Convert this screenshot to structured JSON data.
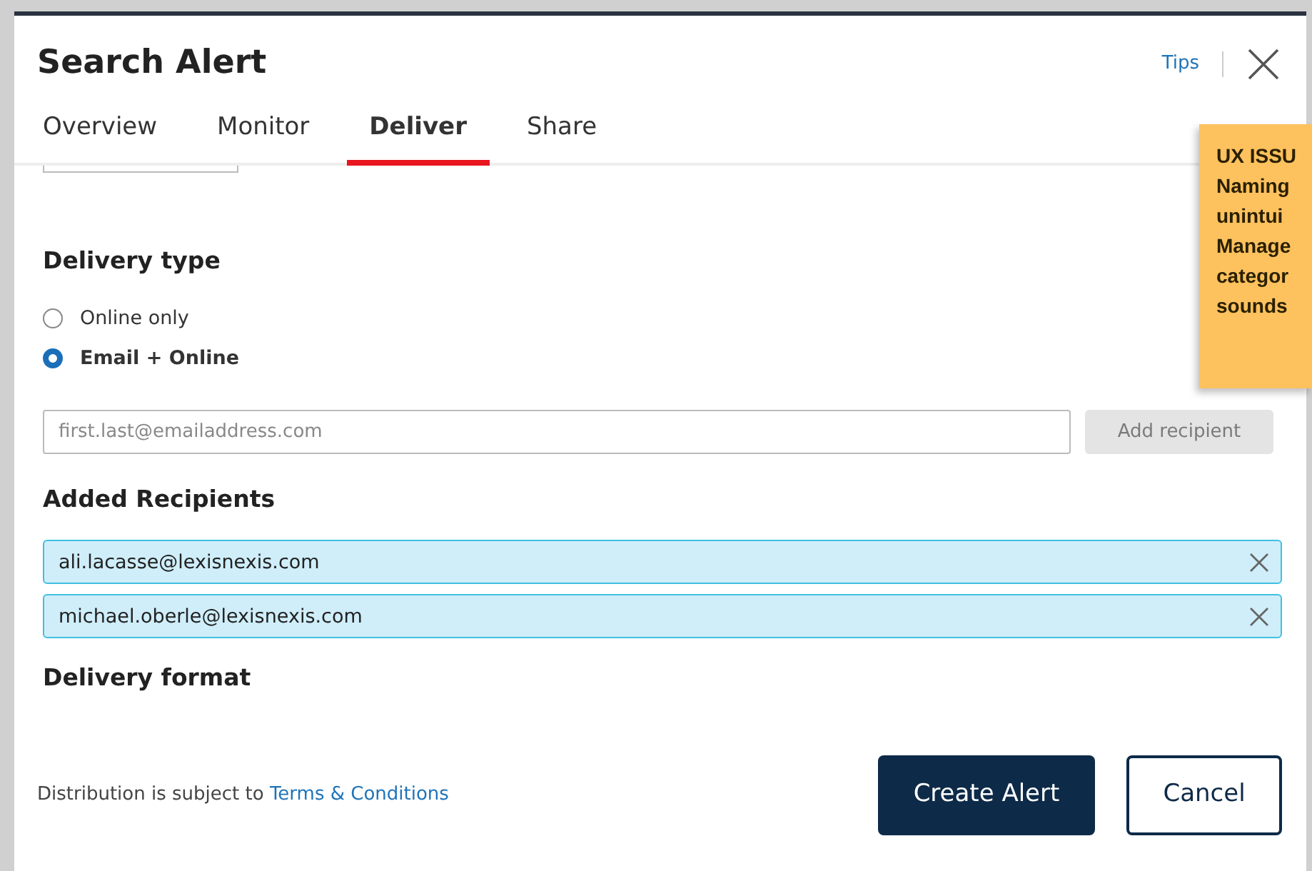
{
  "dialog": {
    "title": "Search Alert",
    "tips_link": "Tips"
  },
  "tabs": [
    {
      "label": "Overview",
      "selected": false
    },
    {
      "label": "Monitor",
      "selected": false
    },
    {
      "label": "Deliver",
      "selected": true
    },
    {
      "label": "Share",
      "selected": false
    }
  ],
  "delivery_type": {
    "heading": "Delivery type",
    "options": [
      {
        "label": "Online only",
        "selected": false
      },
      {
        "label": "Email + Online",
        "selected": true
      }
    ]
  },
  "recipient_input": {
    "placeholder": "first.last@emailaddress.com",
    "button": "Add recipient",
    "button_disabled": true
  },
  "added_recipients": {
    "heading": "Added Recipients",
    "items": [
      "ali.lacasse@lexisnexis.com",
      "michael.oberle@lexisnexis.com"
    ]
  },
  "delivery_format": {
    "heading": "Delivery format"
  },
  "footer": {
    "text": "Distribution is subject to ",
    "link": "Terms & Conditions",
    "primary_button": "Create Alert",
    "secondary_button": "Cancel"
  },
  "sticky_note": {
    "lines": [
      "UX ISSU",
      "Naming",
      "unintui",
      "Manage",
      "categor",
      "sounds"
    ]
  }
}
